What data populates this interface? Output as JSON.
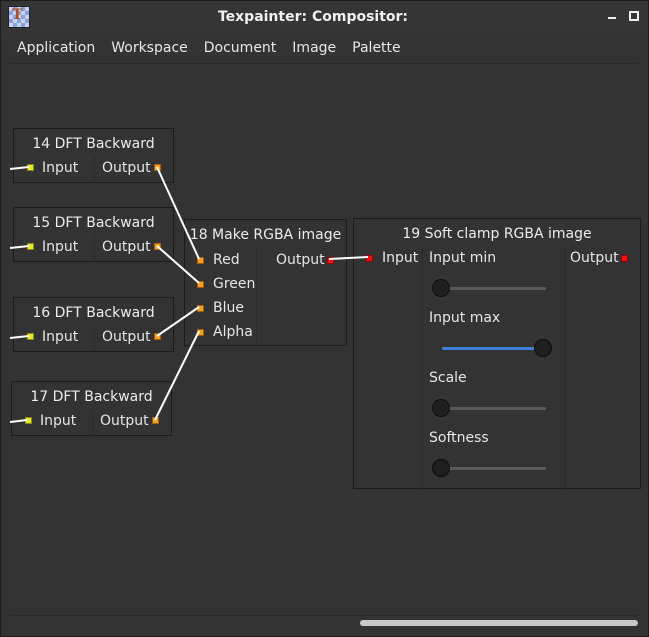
{
  "window": {
    "title": "Texpainter: Compositor:"
  },
  "menu": [
    "Application",
    "Workspace",
    "Document",
    "Image",
    "Palette"
  ],
  "nodes": {
    "n14": {
      "title": "14 DFT Backward",
      "input": "Input",
      "output": "Output"
    },
    "n15": {
      "title": "15 DFT Backward",
      "input": "Input",
      "output": "Output"
    },
    "n16": {
      "title": "16 DFT Backward",
      "input": "Input",
      "output": "Output"
    },
    "n17": {
      "title": "17 DFT Backward",
      "input": "Input",
      "output": "Output"
    },
    "n18": {
      "title": "18 Make RGBA image",
      "inputs": [
        "Red",
        "Green",
        "Blue",
        "Alpha"
      ],
      "output": "Output"
    },
    "n19": {
      "title": "19 Soft clamp RGBA image",
      "input": "Input",
      "output": "Output",
      "params": [
        {
          "label": "Input min",
          "value": 0.0
        },
        {
          "label": "Input max",
          "value": 1.0
        },
        {
          "label": "Scale",
          "value": 0.0
        },
        {
          "label": "Softness",
          "value": 0.0
        }
      ]
    }
  },
  "colors": {
    "port_input_plain": "#e8e830",
    "port_image": "#f5a020",
    "port_rgba": "#ee1111",
    "slider_fill": "#3c7ed8",
    "wire": "#ffffff"
  },
  "scrollbar": {
    "horizontal_visible": true
  }
}
